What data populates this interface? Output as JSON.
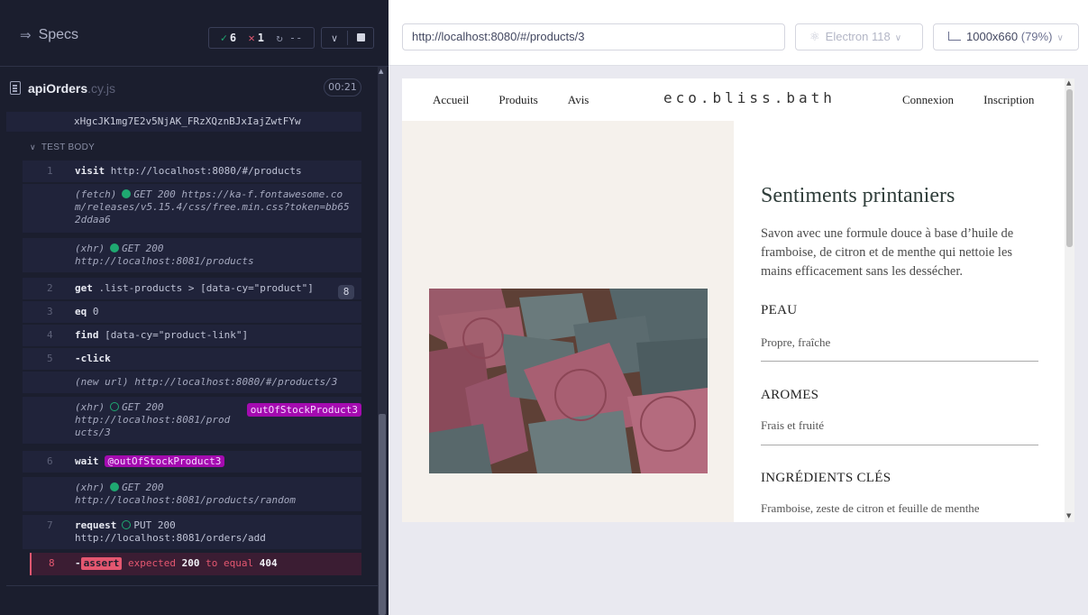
{
  "reporter": {
    "specs_label": "Specs",
    "stats": {
      "passed": "6",
      "failed": "1",
      "pending": "--"
    },
    "spec_file": {
      "name": "apiOrders",
      "ext": ".cy.js",
      "duration": "00:21"
    },
    "token_line": "xHgcJK1mg7E2v5NjAK_FRzXQznBJxIajZwtFYw",
    "test_body_label": "TEST BODY",
    "commands": [
      {
        "num": "1",
        "name": "visit",
        "msg": "http://localhost:8080/#/products"
      },
      {
        "num": "",
        "type": "(fetch)",
        "method": "GET 200",
        "url": "https://ka-f.fontawesome.com/releases/v5.15.4/css/free.min.css?token=bb652ddaa6"
      },
      {
        "num": "",
        "type": "(xhr)",
        "method": "GET 200",
        "url": "http://localhost:8081/products"
      },
      {
        "num": "2",
        "name": "get",
        "msg": ".list-products > [data-cy=\"product\"]",
        "count": "8"
      },
      {
        "num": "3",
        "name": "eq",
        "msg": "0"
      },
      {
        "num": "4",
        "name": "find",
        "msg": "[data-cy=\"product-link\"]"
      },
      {
        "num": "5",
        "name": "-click",
        "msg": ""
      },
      {
        "num": "",
        "type": "(new url)",
        "url": "http://localhost:8080/#/products/3"
      },
      {
        "num": "",
        "type": "(xhr)",
        "method": "GET 200",
        "url": "http://localhost:8081/products/3",
        "alias": "outOfStockProduct3"
      },
      {
        "num": "6",
        "name": "wait",
        "alias": "@outOfStockProduct3"
      },
      {
        "num": "",
        "type": "(xhr)",
        "method": "GET 200",
        "url": "http://localhost:8081/products/random"
      },
      {
        "num": "7",
        "name": "request",
        "method": "PUT 200",
        "url": "http://localhost:8081/orders/add"
      },
      {
        "num": "8",
        "name": "-",
        "badge": "assert",
        "expected": "expected",
        "v1": "200",
        "mid": "to equal",
        "v2": "404"
      }
    ]
  },
  "preview": {
    "url": "http://localhost:8080/#/products/3",
    "browser": "Electron 118",
    "viewport": "1000x660",
    "zoom": "(79%)",
    "site": {
      "nav_left": [
        "Accueil",
        "Produits",
        "Avis"
      ],
      "brand": "eco.bliss.bath",
      "nav_right": [
        "Connexion",
        "Inscription"
      ],
      "product": {
        "title": "Sentiments printaniers",
        "description": "Savon avec une formule douce à base d’huile de framboise, de citron et de menthe qui nettoie les mains efficacement sans les dessécher.",
        "sections": [
          {
            "title": "PEAU",
            "value": "Propre, fraîche"
          },
          {
            "title": "AROMES",
            "value": "Frais et fruité"
          },
          {
            "title": "INGRÉDIENTS CLÉS",
            "value": "Framboise, zeste de citron et feuille de menthe"
          }
        ]
      }
    }
  },
  "colors": {
    "pass": "#1fa971",
    "fail": "#e45770",
    "alias": "#a40bb0",
    "panel": "#1b1e2e"
  }
}
